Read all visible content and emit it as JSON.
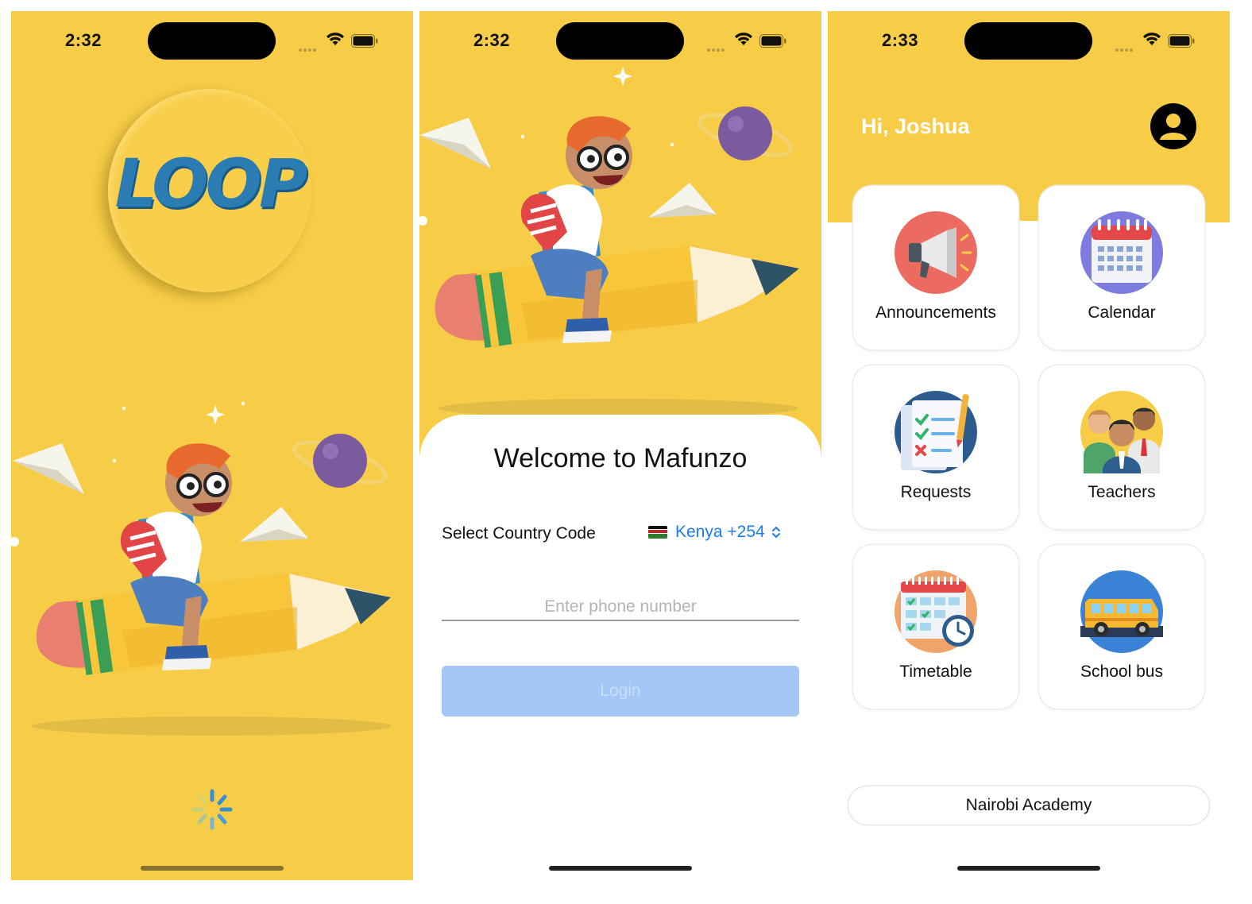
{
  "screens": {
    "splash": {
      "status_time": "2:32",
      "logo_text": "LOOP"
    },
    "login": {
      "status_time": "2:32",
      "welcome_title": "Welcome to Mafunzo",
      "country_code_label": "Select Country Code",
      "country_code_value": "Kenya +254",
      "phone_placeholder": "Enter phone number",
      "login_label": "Login"
    },
    "dashboard": {
      "status_time": "2:33",
      "greeting": "Hi, Joshua",
      "tiles": [
        {
          "label": "Announcements",
          "icon": "megaphone-icon"
        },
        {
          "label": "Calendar",
          "icon": "calendar-icon"
        },
        {
          "label": "Requests",
          "icon": "checklist-icon"
        },
        {
          "label": "Teachers",
          "icon": "teachers-icon"
        },
        {
          "label": "Timetable",
          "icon": "timetable-icon"
        },
        {
          "label": "School bus",
          "icon": "school-bus-icon"
        }
      ],
      "school_name": "Nairobi Academy"
    }
  },
  "colors": {
    "brand_yellow": "#F7CD47",
    "link_blue": "#1A7CF0",
    "login_disabled": "#A3C8F7",
    "logo_blue": "#2B7CB3"
  }
}
